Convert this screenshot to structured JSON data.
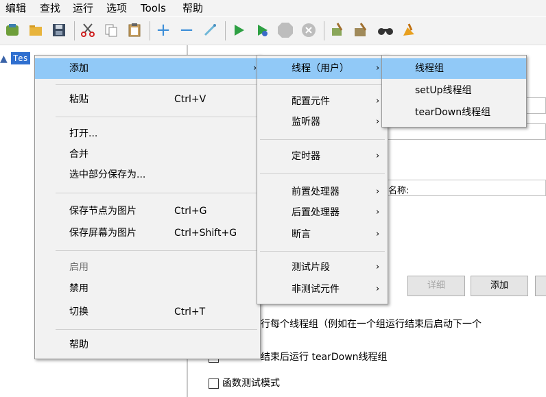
{
  "menubar": {
    "items": [
      {
        "label": "编辑"
      },
      {
        "label": "查找"
      },
      {
        "label": "运行"
      },
      {
        "label": "选项"
      },
      {
        "label": "Tools"
      },
      {
        "label": "帮助"
      }
    ]
  },
  "toolbar": {
    "icons": [
      "new-icon",
      "open-icon",
      "save-icon",
      "cut-icon",
      "copy-icon",
      "paste-icon",
      "expand-icon",
      "collapse-icon",
      "toggle-icon",
      "start-icon",
      "start-no-pause-icon",
      "stop-icon",
      "shutdown-icon",
      "clear-icon",
      "clear-all-icon",
      "search-icon",
      "reset-search-icon"
    ]
  },
  "tree": {
    "node_label": "Tes"
  },
  "right_panel": {
    "name_label": "名称:",
    "buttons": {
      "detail": "详细",
      "add": "添加"
    },
    "text1": "行每个线程组（例如在一个组运行结束后启动下一个",
    "text2": "结束后运行 tearDown线程组",
    "functional_test_label": "函数测试模式"
  },
  "context_menu": {
    "items": [
      {
        "label": "添加",
        "submenu": true
      },
      {
        "label": "粘贴",
        "shortcut": "Ctrl+V"
      },
      {
        "label": "打开..."
      },
      {
        "label": "合并"
      },
      {
        "label": "选中部分保存为..."
      },
      {
        "label": "保存节点为图片",
        "shortcut": "Ctrl+G"
      },
      {
        "label": "保存屏幕为图片",
        "shortcut": "Ctrl+Shift+G"
      },
      {
        "label": "启用",
        "disabled": true
      },
      {
        "label": "禁用"
      },
      {
        "label": "切换",
        "shortcut": "Ctrl+T"
      },
      {
        "label": "帮助"
      }
    ]
  },
  "submenu_add": {
    "items": [
      {
        "label": "线程（用户）",
        "submenu": true
      },
      {
        "label": "配置元件",
        "submenu": true
      },
      {
        "label": "监听器",
        "submenu": true
      },
      {
        "label": "定时器",
        "submenu": true
      },
      {
        "label": "前置处理器",
        "submenu": true
      },
      {
        "label": "后置处理器",
        "submenu": true
      },
      {
        "label": "断言",
        "submenu": true
      },
      {
        "label": "测试片段",
        "submenu": true
      },
      {
        "label": "非测试元件",
        "submenu": true
      }
    ]
  },
  "submenu_threads": {
    "items": [
      {
        "label": "线程组"
      },
      {
        "label": "setUp线程组"
      },
      {
        "label": "tearDown线程组"
      }
    ]
  },
  "arrow_glyph": "›",
  "colors": {
    "highlight": "#91c9f7",
    "menu_bg": "#f2f2f2",
    "selection": "#2f6fcf"
  }
}
